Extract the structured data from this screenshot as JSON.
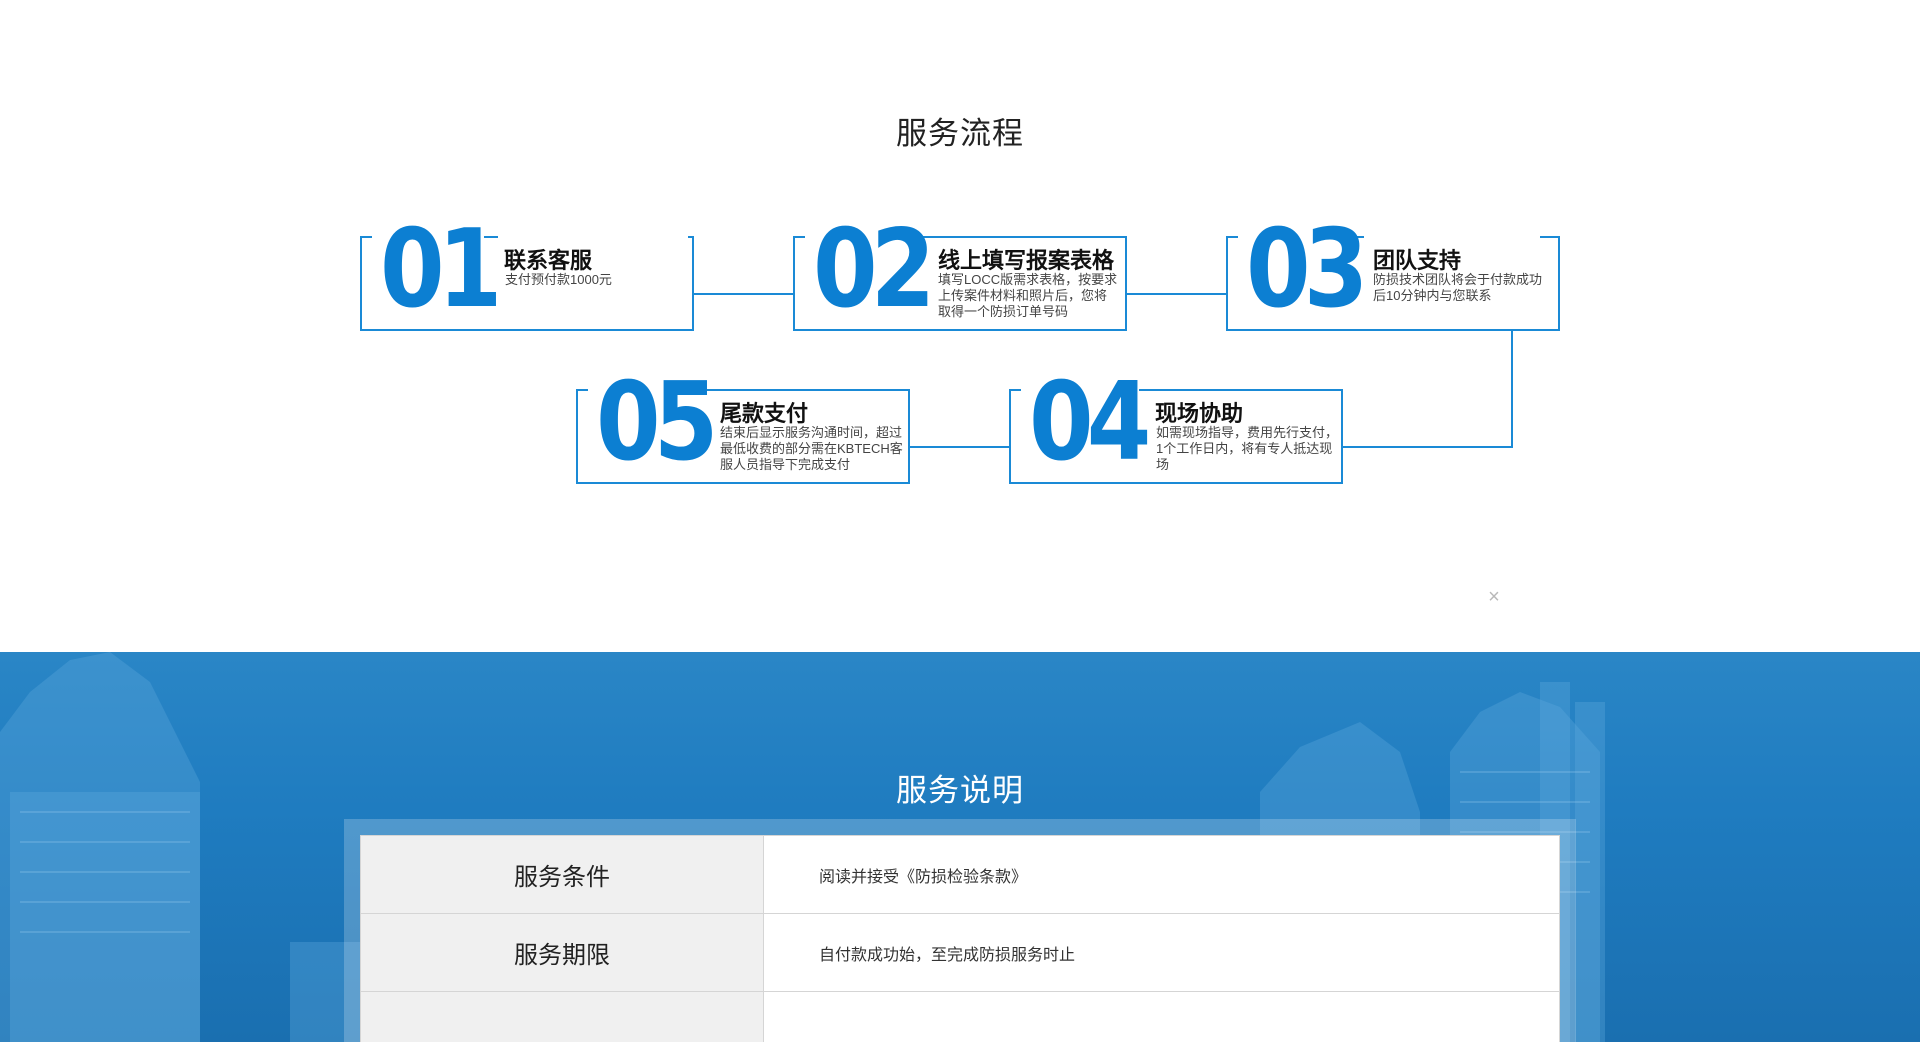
{
  "process": {
    "title": "服务流程",
    "steps": [
      {
        "num": "01",
        "title": "联系客服",
        "desc": "支付预付款1000元"
      },
      {
        "num": "02",
        "title": "线上填写报案表格",
        "desc": "填写LOCC版需求表格，按要求上传案件材料和照片后，您将取得一个防损订单号码"
      },
      {
        "num": "03",
        "title": "团队支持",
        "desc": "防损技术团队将会于付款成功后10分钟内与您联系"
      },
      {
        "num": "04",
        "title": "现场协助",
        "desc": "如需现场指导，费用先行支付，1个工作日内，将有专人抵达现场"
      },
      {
        "num": "05",
        "title": "尾款支付",
        "desc": "结束后显示服务沟通时间，超过最低收费的部分需在KBTECH客服人员指导下完成支付"
      }
    ],
    "close_icon": "×"
  },
  "service": {
    "title": "服务说明",
    "rows": [
      {
        "label": "服务条件",
        "value": "阅读并接受《防损检验条款》"
      },
      {
        "label": "服务期限",
        "value": "自付款成功始，至完成防损服务时止"
      },
      {
        "label": "",
        "value": ""
      }
    ]
  },
  "colors": {
    "accent": "#0c7fd2",
    "line": "#1a8ad6",
    "band": "#2a86c6"
  }
}
